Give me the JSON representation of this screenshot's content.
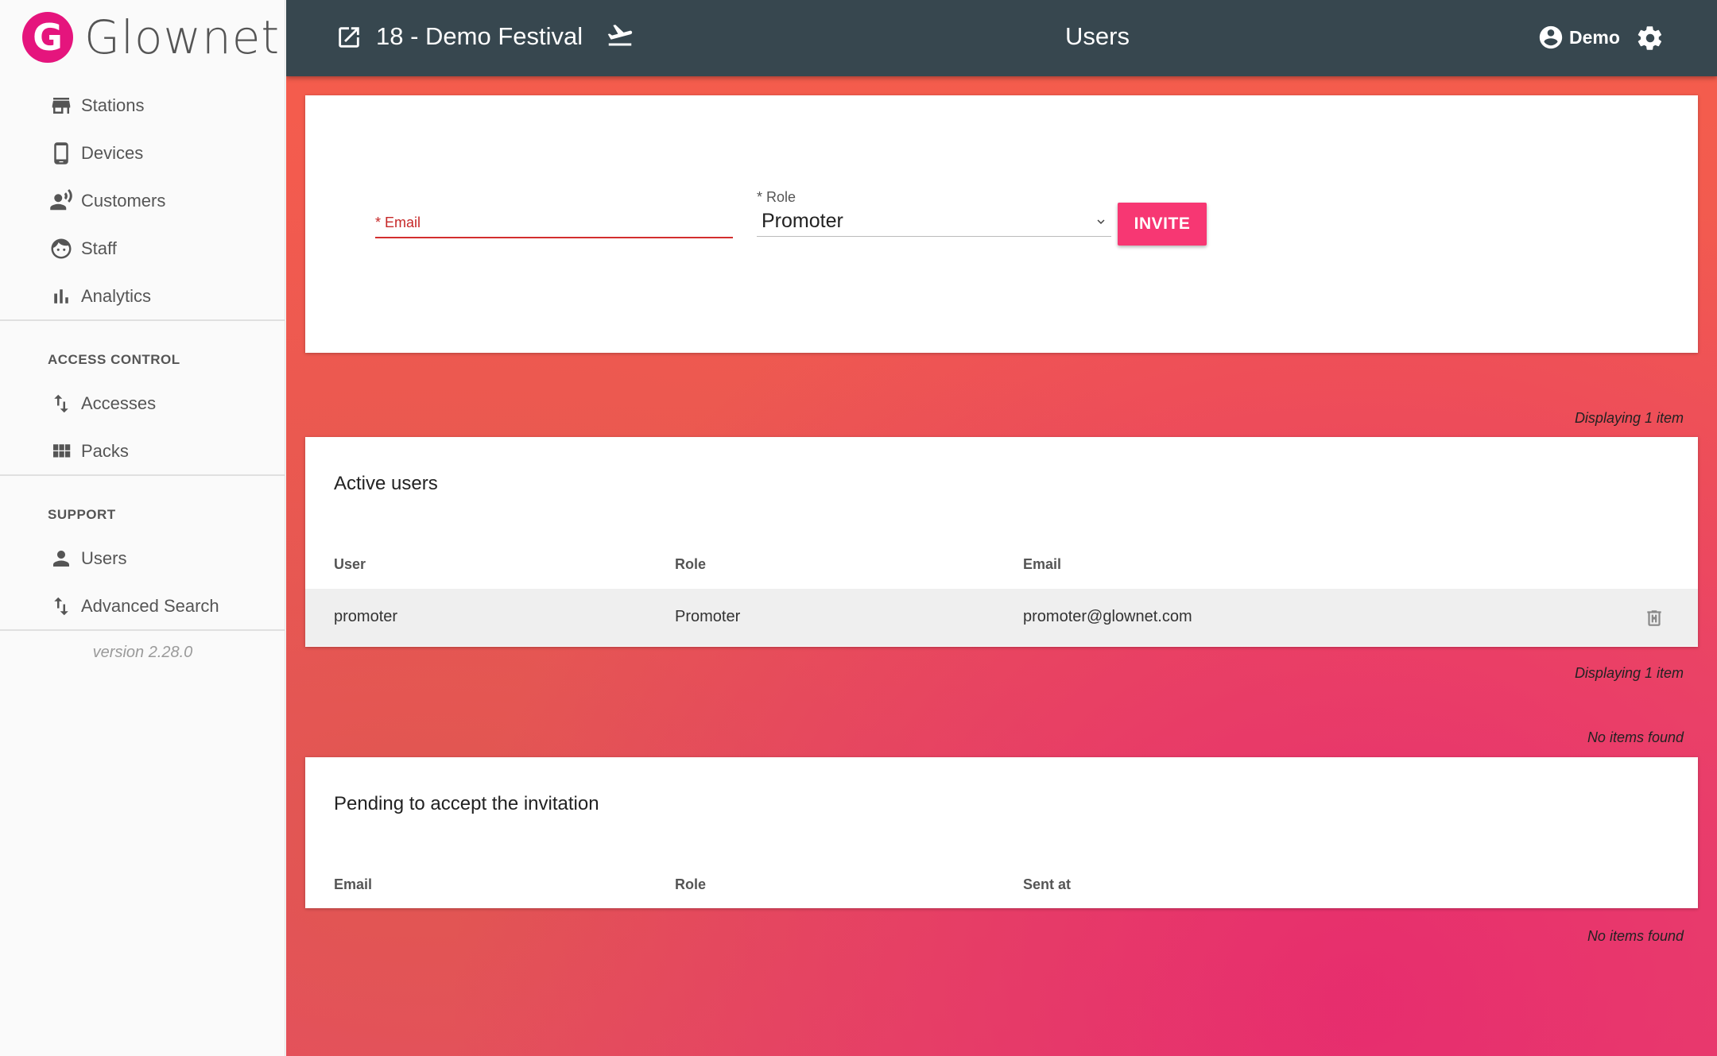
{
  "brand": {
    "logo_letter": "G",
    "name": "Glownet"
  },
  "sidebar": {
    "items": [
      {
        "label": "Stations",
        "icon": "store-icon"
      },
      {
        "label": "Devices",
        "icon": "phone-icon"
      },
      {
        "label": "Customers",
        "icon": "customers-icon"
      },
      {
        "label": "Staff",
        "icon": "face-icon"
      },
      {
        "label": "Analytics",
        "icon": "bar-chart-icon"
      }
    ],
    "access_control": {
      "title": "ACCESS CONTROL",
      "items": [
        {
          "label": "Accesses",
          "icon": "swap-vertical-icon"
        },
        {
          "label": "Packs",
          "icon": "grid-icon"
        }
      ]
    },
    "support": {
      "title": "SUPPORT",
      "items": [
        {
          "label": "Users",
          "icon": "person-icon"
        },
        {
          "label": "Advanced Search",
          "icon": "swap-vertical-icon"
        }
      ]
    },
    "version": "version 2.28.0"
  },
  "topbar": {
    "event_title": "18 - Demo Festival",
    "page_title": "Users",
    "user_name": "Demo",
    "icons": [
      "open-in-new-icon",
      "flight-takeoff-icon",
      "account-circle-icon",
      "gear-icon"
    ]
  },
  "invite_form": {
    "email_label": "Email",
    "email_value": "",
    "role_label": "Role",
    "role_value": "Promoter",
    "required_mark": "*",
    "invite_button": "INVITE"
  },
  "active_users": {
    "count_text": "Displaying 1 item",
    "title": "Active users",
    "columns": [
      "User",
      "Role",
      "Email"
    ],
    "rows": [
      {
        "user": "promoter",
        "role": "Promoter",
        "email": "promoter@glownet.com"
      }
    ],
    "footer_text": "Displaying 1 item"
  },
  "pending": {
    "count_text": "No items found",
    "title": "Pending to accept the invitation",
    "columns": [
      "Email",
      "Role",
      "Sent at"
    ],
    "footer_text": "No items found"
  },
  "colors": {
    "brand": "#e5157d",
    "topbar": "#37474f",
    "invite_button": "#f73773",
    "error": "#d32f2f"
  }
}
